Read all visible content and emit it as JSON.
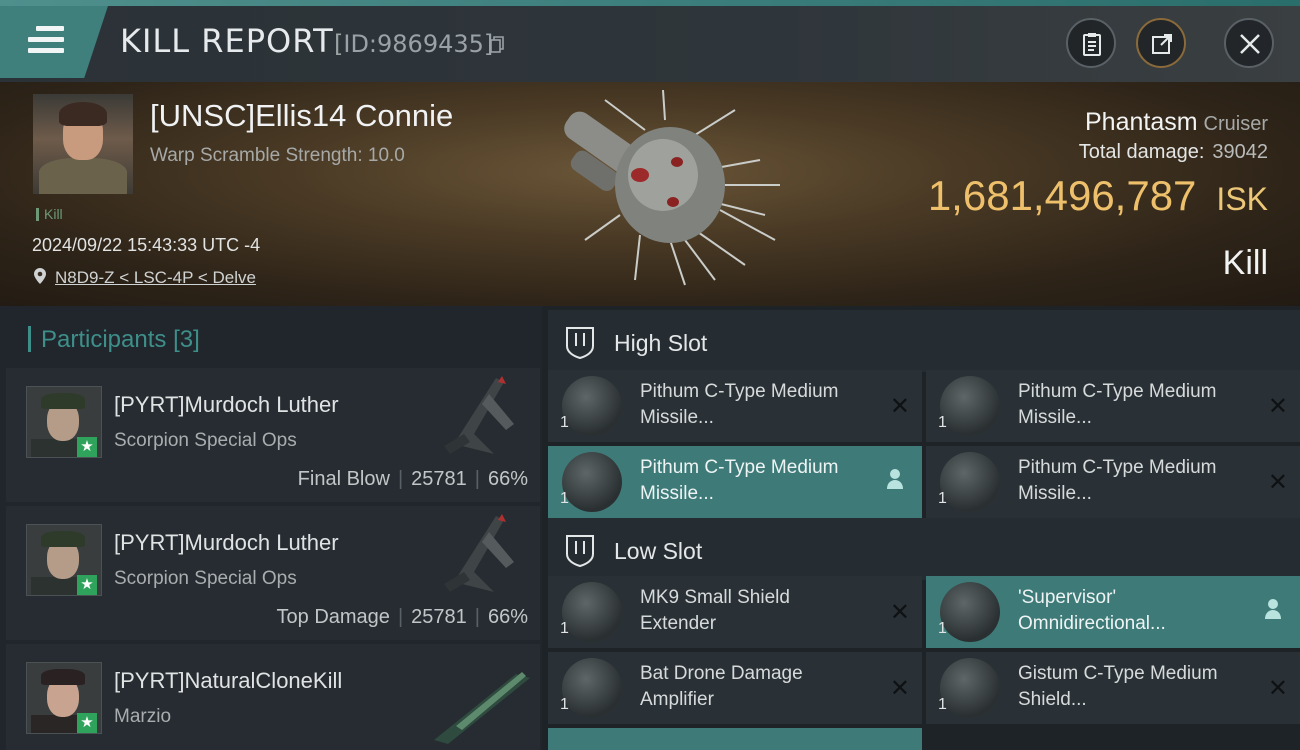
{
  "header": {
    "title": "KILL REPORT",
    "report_id": "[ID:9869435]"
  },
  "victim": {
    "name": "[UNSC]Ellis14 Connie",
    "subtitle": "Warp Scramble Strength: 10.0",
    "tag": "Kill",
    "timestamp": "2024/09/22 15:43:33 UTC -4",
    "location": "N8D9-Z < LSC-4P < Delve"
  },
  "ship": {
    "name": "Phantasm",
    "class": "Cruiser",
    "total_damage_label": "Total damage:",
    "total_damage": "39042",
    "isk_value": "1,681,496,787",
    "isk_unit": "ISK",
    "result": "Kill"
  },
  "participants": {
    "title": "Participants",
    "count": "[3]",
    "rows": [
      {
        "name": "[PYRT]Murdoch Luther",
        "ship": "Scorpion Special Ops",
        "role": "Final Blow",
        "damage": "25781",
        "percent": "66%"
      },
      {
        "name": "[PYRT]Murdoch Luther",
        "ship": "Scorpion Special Ops",
        "role": "Top Damage",
        "damage": "25781",
        "percent": "66%"
      },
      {
        "name": "[PYRT]NaturalCloneKill",
        "ship": "Marzio",
        "role": "",
        "damage": "",
        "percent": ""
      }
    ]
  },
  "slots": {
    "high": {
      "label": "High Slot",
      "modules": [
        {
          "name": "Pithum C-Type Medium Missile...",
          "qty": "1"
        },
        {
          "name": "Pithum C-Type Medium Missile...",
          "qty": "1"
        },
        {
          "name": "Pithum C-Type Medium Missile...",
          "qty": "1"
        },
        {
          "name": "Pithum C-Type Medium Missile...",
          "qty": "1"
        }
      ]
    },
    "low": {
      "label": "Low Slot",
      "modules": [
        {
          "name": "MK9 Small Shield Extender",
          "qty": "1"
        },
        {
          "name": "'Supervisor' Omnidirectional...",
          "qty": "1"
        },
        {
          "name": "Bat Drone Damage Amplifier",
          "qty": "1"
        },
        {
          "name": "Gistum C-Type Medium Shield...",
          "qty": "1"
        }
      ]
    }
  },
  "colors": {
    "accent": "#3e7b78",
    "isk": "#eec06b",
    "star": "#2fa35b"
  }
}
